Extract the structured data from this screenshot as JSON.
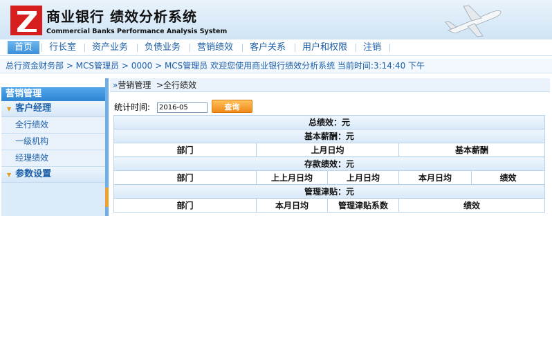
{
  "brand": {
    "title_cn": "商业银行  绩效分析系统",
    "title_en": "Commercial Banks  Performance Analysis System"
  },
  "nav": {
    "items": [
      "首页",
      "行长室",
      "资产业务",
      "负债业务",
      "营销绩效",
      "客户关系",
      "用户和权限",
      "注销"
    ]
  },
  "infobar": {
    "text": "总行资金财务部 > MCS管理员 > 0000 > MCS管理员  欢迎您使用商业银行绩效分析系统   当前时间:3:14:40 下午"
  },
  "sidebar": {
    "header": "营销管理",
    "groups": [
      {
        "label": "客户经理",
        "items": [
          "全行绩效",
          "一级机构",
          "经理绩效"
        ]
      },
      {
        "label": "参数设置",
        "items": []
      }
    ]
  },
  "breadcrumb": {
    "icon": "»",
    "section": "营销管理",
    "page": ">全行绩效"
  },
  "filter": {
    "label": "统计时间:",
    "date_value": "2016-05",
    "query_label": "查询"
  },
  "report": {
    "total": "总绩效：元",
    "basic_title": "基本薪酬：元",
    "basic_headers": [
      "部门",
      "上月日均",
      "基本薪酬"
    ],
    "deposit_title": "存款绩效：元",
    "deposit_headers": [
      "部门",
      "上上月日均",
      "上月日均",
      "本月日均",
      "绩效"
    ],
    "mgmt_title": "管理津贴：元",
    "mgmt_headers": [
      "部门",
      "本月日均",
      "管理津贴系数",
      "绩效"
    ]
  },
  "colors": {
    "accent": "#1d5fa8",
    "logo_red": "#d71e1e",
    "button_orange": "#f0891a"
  }
}
